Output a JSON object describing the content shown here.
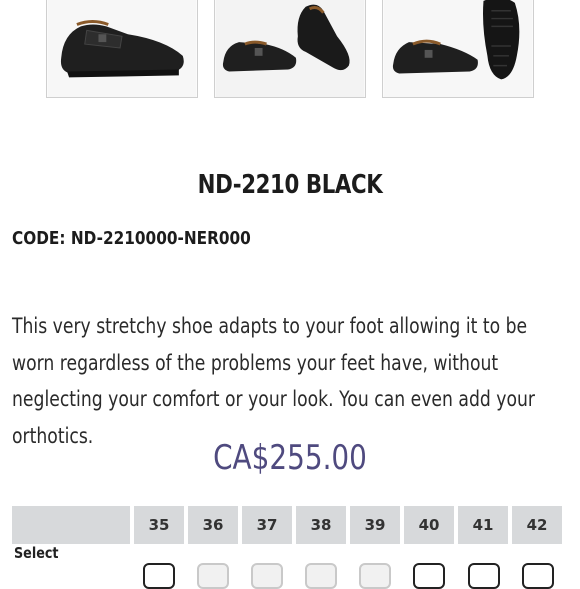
{
  "product": {
    "name": "ND-2210 BLACK",
    "code_line": "CODE: ND-2210000-NER000",
    "description": "This very stretchy shoe adapts to your foot allowing it to be worn regardless of the problems your feet have, without neglecting your comfort or your look. You can even add your orthotics.",
    "price": "CA$255.00"
  },
  "gallery": {
    "images": [
      {
        "icon": "shoe-side-view-image"
      },
      {
        "icon": "shoe-pair-image"
      },
      {
        "icon": "shoe-sole-image"
      }
    ]
  },
  "sizes": {
    "row_label": "Select",
    "items": [
      {
        "size": "35",
        "available": true
      },
      {
        "size": "36",
        "available": false
      },
      {
        "size": "37",
        "available": false
      },
      {
        "size": "38",
        "available": false
      },
      {
        "size": "39",
        "available": false
      },
      {
        "size": "40",
        "available": true
      },
      {
        "size": "41",
        "available": true
      },
      {
        "size": "42",
        "available": true
      }
    ]
  },
  "colors": {
    "price": "#4f4a7f",
    "header_bg": "#d7d9db"
  }
}
